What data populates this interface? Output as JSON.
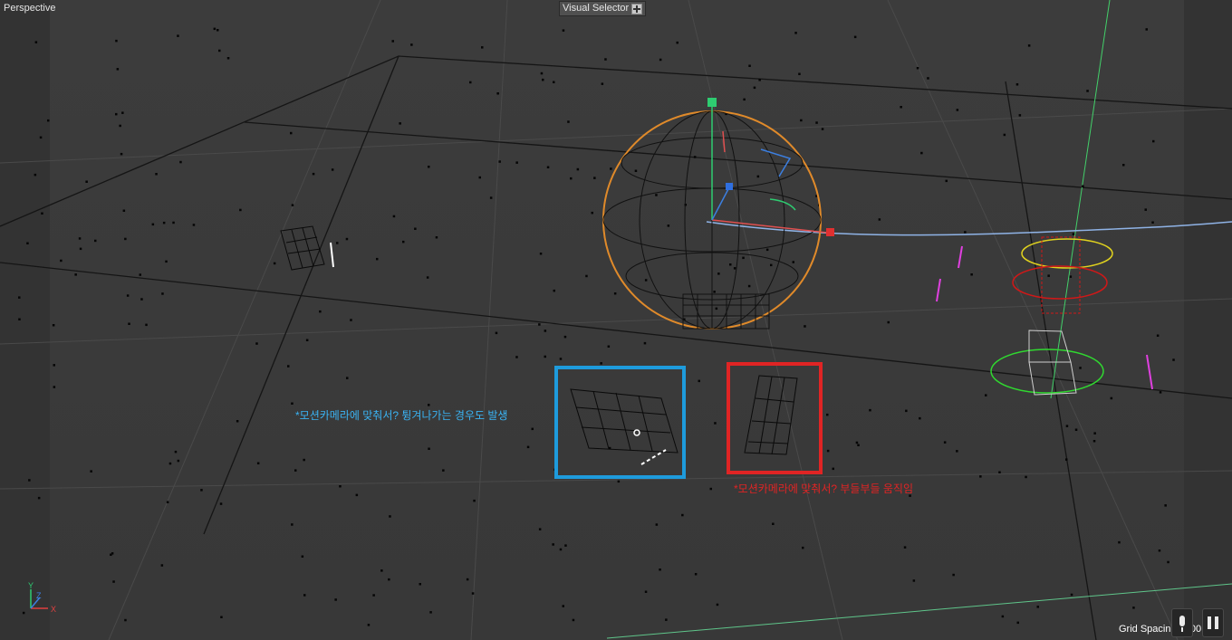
{
  "viewport": {
    "view_name": "Perspective",
    "visual_selector_label": "Visual Selector",
    "grid_spacing_label": "Grid Spacing : 100",
    "annotations": {
      "blue": "*모션카메라에 맞춰서? 튕겨나가는 경우도 발생",
      "red": "*모션카메라에 맞춰서? 부들부들 움직임"
    },
    "axis_labels": {
      "y": "Y",
      "z": "Z",
      "x": "X"
    },
    "colors": {
      "background": "#3a3a3a",
      "annotation_blue": "#1e9bdc",
      "annotation_red": "#e02424",
      "selection_orange": "#e08a2a",
      "path_blue": "#8fb3e6"
    },
    "icons": [
      "visual-selector-icon",
      "microphone-icon",
      "pause-icon",
      "axis-gizmo-icon"
    ]
  }
}
